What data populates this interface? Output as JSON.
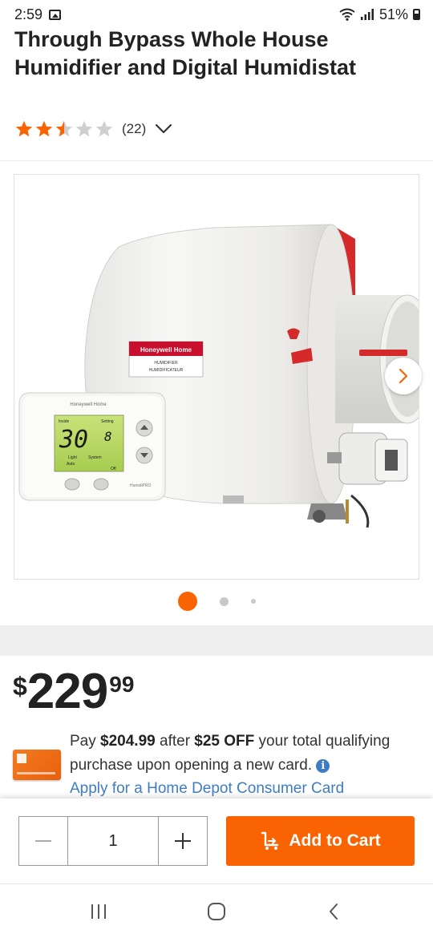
{
  "status_bar": {
    "time": "2:59",
    "battery": "51%"
  },
  "product": {
    "title": "Through Bypass Whole House Humidifier and Digital Humidistat",
    "rating": 2.5,
    "rating_max": 5,
    "review_count": "(22)"
  },
  "gallery": {
    "current_index": 1,
    "dot_count": 3,
    "image_alt": "Honeywell Home humidifier with HumidiPRO thermostat",
    "humidifier_brand": "Honeywell Home",
    "humidifier_label_1": "HUMIDIFIER",
    "humidifier_label_2": "HUMIDIFICATEUR",
    "thermostat_brand": "Honeywell Home",
    "thermostat_model": "HumidiPRO",
    "display_inside": "Inside",
    "display_setting": "Setting",
    "display_value": "30",
    "display_setting_value": "8",
    "display_light": "Light",
    "display_system": "System",
    "display_auto": "Auto",
    "display_off": "Off"
  },
  "price": {
    "currency": "$",
    "dollars": "229",
    "cents": "99"
  },
  "promo": {
    "text_1": "Pay ",
    "amount": "$204.99",
    "text_2": " after ",
    "discount": "$25 OFF",
    "text_3": " your total qualifying purchase upon opening a new card. ",
    "info_icon": "i",
    "apply_link": "Apply for a Home Depot Consumer Card"
  },
  "cart": {
    "quantity": "1",
    "add_label": "Add to Cart"
  },
  "colors": {
    "accent": "#f96302",
    "link": "#3e7dc3",
    "star": "#f96302"
  }
}
